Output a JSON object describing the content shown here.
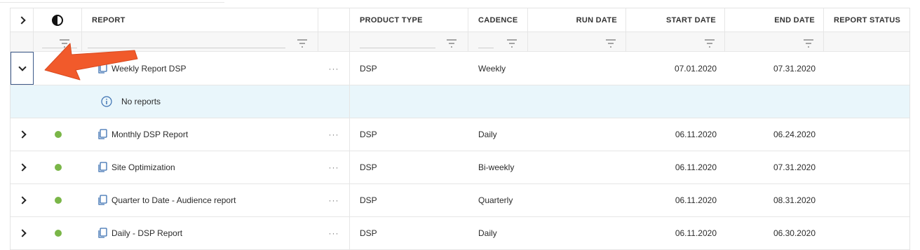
{
  "columns": {
    "expand": "",
    "status_toggle": "",
    "report": "REPORT",
    "product_type": "PRODUCT TYPE",
    "cadence": "CADENCE",
    "run_date": "RUN DATE",
    "start_date": "START DATE",
    "end_date": "END DATE",
    "report_status": "REPORT STATUS"
  },
  "expanded_row": {
    "report": "Weekly Report DSP",
    "product_type": "DSP",
    "cadence": "Weekly",
    "run_date": "",
    "start_date": "07.01.2020",
    "end_date": "07.31.2020",
    "detail_message": "No reports"
  },
  "rows": [
    {
      "report": "Monthly DSP Report",
      "product_type": "DSP",
      "cadence": "Daily",
      "run_date": "",
      "start_date": "06.11.2020",
      "end_date": "06.24.2020"
    },
    {
      "report": "Site Optimization",
      "product_type": "DSP",
      "cadence": "Bi-weekly",
      "run_date": "",
      "start_date": "06.11.2020",
      "end_date": "07.31.2020"
    },
    {
      "report": "Quarter to Date - Audience report",
      "product_type": "DSP",
      "cadence": "Quarterly",
      "run_date": "",
      "start_date": "06.11.2020",
      "end_date": "08.31.2020"
    },
    {
      "report": "Daily - DSP Report",
      "product_type": "DSP",
      "cadence": "Daily",
      "run_date": "",
      "start_date": "06.11.2020",
      "end_date": "06.30.2020"
    }
  ],
  "more_label": "···",
  "colors": {
    "status_active": "#7ab648",
    "detail_bg": "#e9f6fb",
    "arrow": "#f15a2b",
    "border": "#e6e6e6",
    "icon_blue": "#3a6fb0"
  },
  "icons": [
    "chevron-right-icon",
    "chevron-down-icon",
    "contrast-icon",
    "filter-icon",
    "copy-icon",
    "info-icon",
    "more-icon"
  ]
}
